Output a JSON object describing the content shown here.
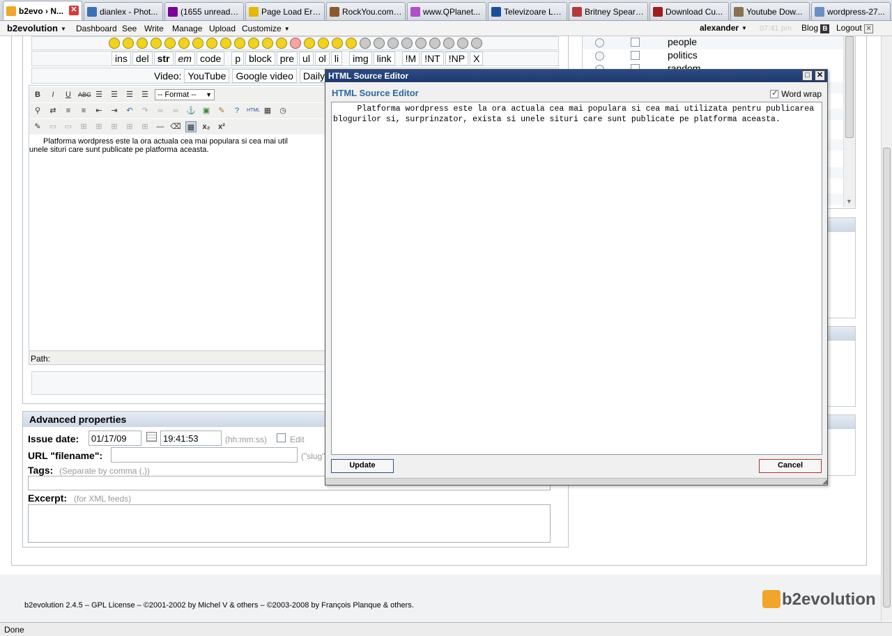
{
  "browser": {
    "tabs": [
      {
        "label": "b2evo › N...",
        "icon": "b2evo-icon",
        "color": "#f2a52a",
        "active": true
      },
      {
        "label": "dianlex - Phot...",
        "icon": "photo-icon",
        "color": "#3b6fb6"
      },
      {
        "label": "(1655 unread) ...",
        "icon": "yahoo-icon",
        "color": "#7b0099"
      },
      {
        "label": "Page Load Error",
        "icon": "warning-icon",
        "color": "#e6b800"
      },
      {
        "label": "RockYou.com ...",
        "icon": "rockyou-icon",
        "color": "#8b5a2b"
      },
      {
        "label": "www.QPlanet...",
        "icon": "qplanet-icon",
        "color": "#b04fc9"
      },
      {
        "label": "Televizoare LCD",
        "icon": "tv-icon",
        "color": "#1a4f9c"
      },
      {
        "label": "Britney Spears...",
        "icon": "music-icon",
        "color": "#b33a3a"
      },
      {
        "label": "Download Cu...",
        "icon": "download-icon",
        "color": "#a11d1d"
      },
      {
        "label": "Youtube Dow...",
        "icon": "youtube-icon",
        "color": "#8a7251"
      },
      {
        "label": "wordpress-27...",
        "icon": "page-icon",
        "color": "#6a8fc4"
      }
    ],
    "status": "Done"
  },
  "menubar": {
    "brand": "b2evolution",
    "items": [
      "Dashboard",
      "See",
      "Write",
      "Manage",
      "Upload",
      "Customize"
    ],
    "user": "alexander",
    "time": "07:41 pm",
    "blog": "Blog",
    "logout": "Logout"
  },
  "quicktags": {
    "buttons": [
      "ins",
      "del",
      "str",
      "em",
      "code",
      "p",
      "block",
      "pre",
      "ul",
      "ol",
      "li",
      "img",
      "link",
      "!M",
      "!NT",
      "!NP",
      "X"
    ],
    "video_label": "Video:",
    "video_buttons": [
      "YouTube",
      "Google video",
      "Daily"
    ]
  },
  "editor": {
    "format_select": "-- Format --",
    "content": "Platforma wordpress este la ora actuala cea mai populara si cea mai util",
    "content_line2": "unele situri care sunt publicate pe platforma aceasta.",
    "path_label": "Path:"
  },
  "advanced": {
    "title": "Advanced properties",
    "issue_date_label": "Issue date:",
    "issue_date": "01/17/09",
    "issue_time": "19:41:53",
    "time_format": "(hh:mm:ss)",
    "edit_label": "Edit",
    "url_label": "URL \"filename\":",
    "url_note": "(\"slug\"",
    "tags_label": "Tags:",
    "tags_note": "(Separate by comma (,))",
    "excerpt_label": "Excerpt:",
    "excerpt_note": "(for XML feeds)"
  },
  "categories": [
    "people",
    "politics",
    "random"
  ],
  "modal": {
    "title": "HTML Source Editor",
    "heading": "HTML Source Editor",
    "word_wrap": "Word wrap",
    "source": "     Platforma wordpress este la ora actuala cea mai populara si cea mai utilizata pentru publicarea blogurilor si, surprinzator, exista si unele situri care sunt publicate pe platforma aceasta.",
    "update": "Update",
    "cancel": "Cancel"
  },
  "footer": {
    "text": "b2evolution 2.4.5 – GPL License – ©2001-2002 by Michel V & others – ©2003-2008 by François Planque & others.",
    "logo": "b2evolution"
  }
}
